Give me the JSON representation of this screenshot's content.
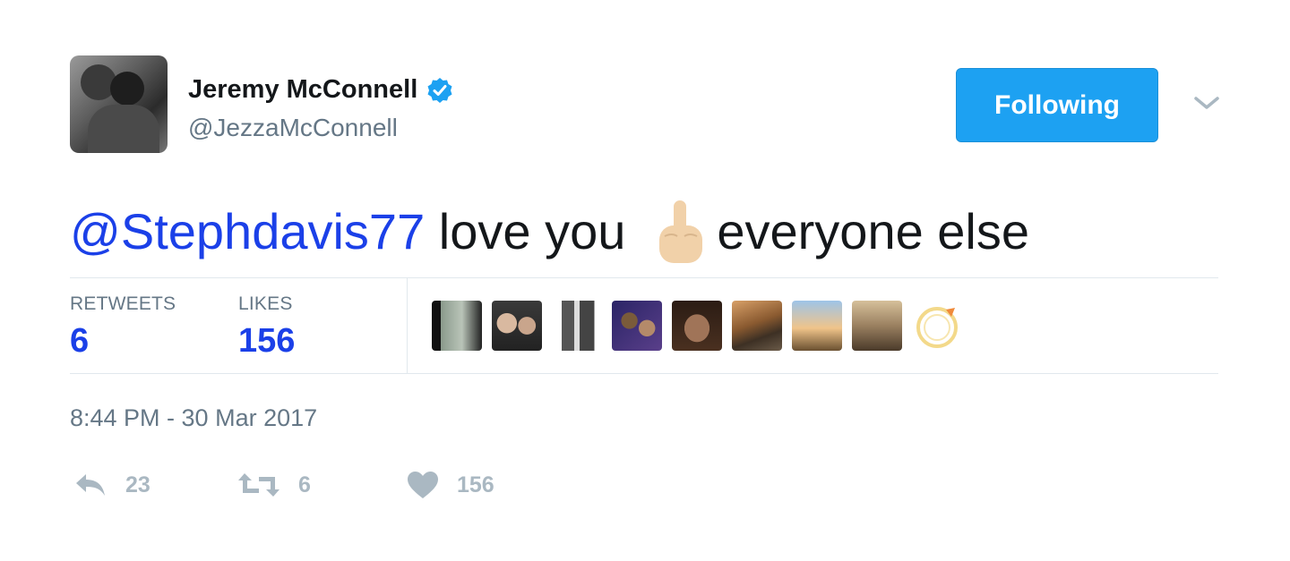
{
  "user": {
    "name": "Jeremy McConnell",
    "handle": "@JezzaMcConnell",
    "verified": true
  },
  "follow_button": {
    "label": "Following",
    "color": "#1da1f2"
  },
  "tweet": {
    "mention": "@Stephdavis77",
    "text_before_emoji": " love you",
    "emoji": "middle-finger-emoji",
    "text_after_emoji": "everyone else"
  },
  "stats": {
    "retweets_label": "RETWEETS",
    "retweets_value": "6",
    "likes_label": "LIKES",
    "likes_value": "156"
  },
  "likers": [
    {
      "icon": "liker-avatar"
    },
    {
      "icon": "liker-avatar"
    },
    {
      "icon": "liker-avatar"
    },
    {
      "icon": "liker-avatar"
    },
    {
      "icon": "liker-avatar"
    },
    {
      "icon": "liker-avatar"
    },
    {
      "icon": "liker-avatar"
    },
    {
      "icon": "liker-avatar"
    },
    {
      "icon": "liker-avatar"
    }
  ],
  "timestamp": "8:44 PM - 30 Mar 2017",
  "actions": {
    "reply_count": "23",
    "retweet_count": "6",
    "like_count": "156"
  },
  "colors": {
    "link": "#1b40e8",
    "muted": "#657786",
    "action_gray": "#aab8c2"
  }
}
